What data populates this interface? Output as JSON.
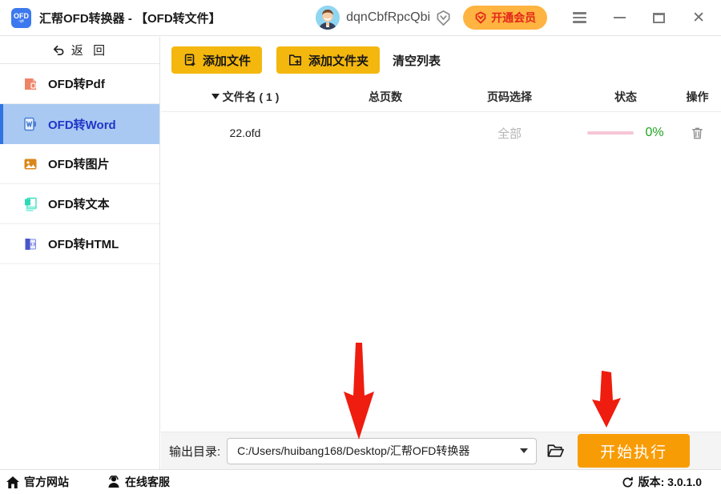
{
  "window": {
    "app_icon_label": "OFD",
    "title": "汇帮OFD转换器 - 【OFD转文件】"
  },
  "titlebar": {
    "username": "dqnCbfRpcQbi",
    "member_button_label": "开通会员"
  },
  "sidebar": {
    "back_label": "返 回",
    "items": [
      {
        "label": "OFD转Pdf"
      },
      {
        "label": "OFD转Word",
        "active": true
      },
      {
        "label": "OFD转图片"
      },
      {
        "label": "OFD转文本"
      },
      {
        "label": "OFD转HTML"
      }
    ]
  },
  "toolbar": {
    "add_file_label": "添加文件",
    "add_folder_label": "添加文件夹",
    "clear_list_label": "清空列表"
  },
  "table": {
    "header": {
      "name": "文件名 ( 1 )",
      "total_pages": "总页数",
      "page_select": "页码选择",
      "status": "状态",
      "action": "操作"
    },
    "row": {
      "name": "22.ofd",
      "total_pages": "",
      "page_select": "全部",
      "progress_percent": "0%"
    }
  },
  "output_bar": {
    "label": "输出目录:",
    "path": "C:/Users/huibang168/Desktop/汇帮OFD转换器",
    "start_button_label": "开始执行"
  },
  "status_bar": {
    "official_site": "官方网站",
    "online_support": "在线客服",
    "version_text": "版本:  3.0.1.0"
  },
  "colors": {
    "accent_blue": "#2f74e0",
    "selected_bg": "#a9c9f2",
    "selected_text": "#2036c8",
    "button_yellow": "#f4b70e",
    "button_orange": "#f89c05",
    "member_bg_orange": "#ffb340",
    "member_red": "#e3261a",
    "progress_pink": "#f6c6d6",
    "percent_green": "#1fa41f",
    "arrow_red": "#ee1d0f"
  }
}
